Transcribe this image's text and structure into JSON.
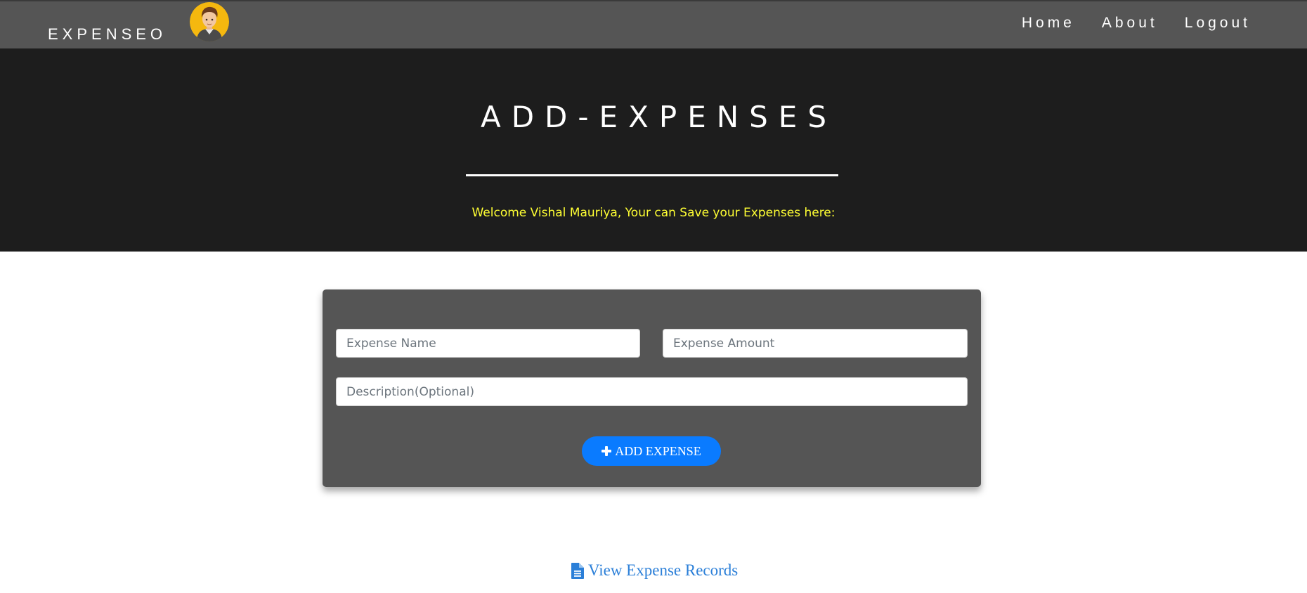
{
  "navbar": {
    "brand": "EXPENSEO",
    "links": [
      {
        "label": "Home"
      },
      {
        "label": "About"
      },
      {
        "label": "Logout"
      }
    ]
  },
  "hero": {
    "title": "ADD-EXPENSES",
    "welcome": "Welcome Vishal Mauriya, Your can Save your Expenses here:"
  },
  "form": {
    "expense_name": {
      "value": "",
      "placeholder": "Expense Name"
    },
    "expense_amount": {
      "value": "",
      "placeholder": "Expense Amount"
    },
    "description": {
      "value": "",
      "placeholder": "Description(Optional)"
    },
    "submit_label": "ADD EXPENSE",
    "submit_icon": "plus-icon"
  },
  "footer_link": {
    "label": "View Expense Records",
    "icon": "file-text-icon"
  },
  "colors": {
    "navbar_bg": "#555555",
    "hero_bg": "#1d1d1d",
    "welcome_text": "#ffff33",
    "card_bg": "#555555",
    "button_bg": "#0a7bff",
    "link": "#2b7fd8"
  }
}
